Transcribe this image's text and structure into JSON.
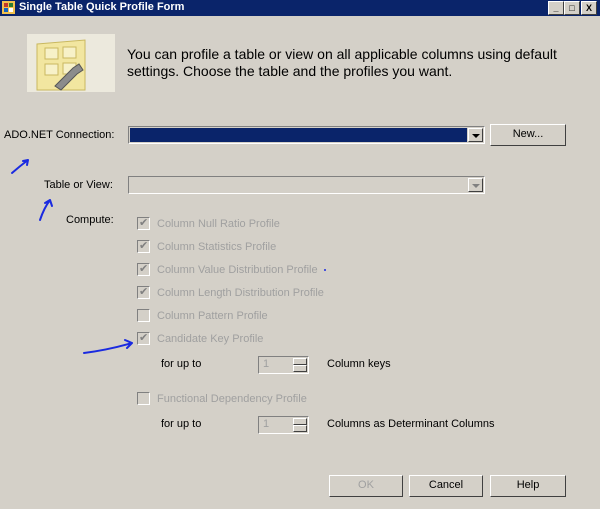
{
  "window": {
    "title": "Single Table Quick Profile Form",
    "minimize": "_",
    "maximize": "□",
    "close": "X"
  },
  "intro_text": "You can profile a table or view on all applicable columns using default settings. Choose the table and the profiles you want.",
  "connection": {
    "label": "ADO.NET Connection:",
    "value": "",
    "new_button": "New..."
  },
  "table": {
    "label": "Table or View:",
    "value": ""
  },
  "compute_label": "Compute:",
  "profiles": [
    {
      "label": "Column Null Ratio Profile",
      "checked": true
    },
    {
      "label": "Column Statistics Profile",
      "checked": true
    },
    {
      "label": "Column Value Distribution Profile",
      "checked": true
    },
    {
      "label": "Column Length Distribution Profile",
      "checked": true
    },
    {
      "label": "Column Pattern Profile",
      "checked": false
    },
    {
      "label": "Candidate Key Profile",
      "checked": true
    }
  ],
  "candidate_key": {
    "for_up_to": "for up to",
    "value": "1",
    "unit": "Column keys"
  },
  "functional_dependency": {
    "label": "Functional Dependency Profile",
    "checked": false,
    "for_up_to": "for up to",
    "value": "1",
    "unit": "Columns as Determinant Columns"
  },
  "buttons": {
    "ok": "OK",
    "cancel": "Cancel",
    "help": "Help"
  },
  "colors": {
    "title_bar": "#0a246a",
    "dialog_bg": "#d4d0c8",
    "selected_combo": "#0a246a",
    "annotation_ink": "#1a2ae0"
  }
}
